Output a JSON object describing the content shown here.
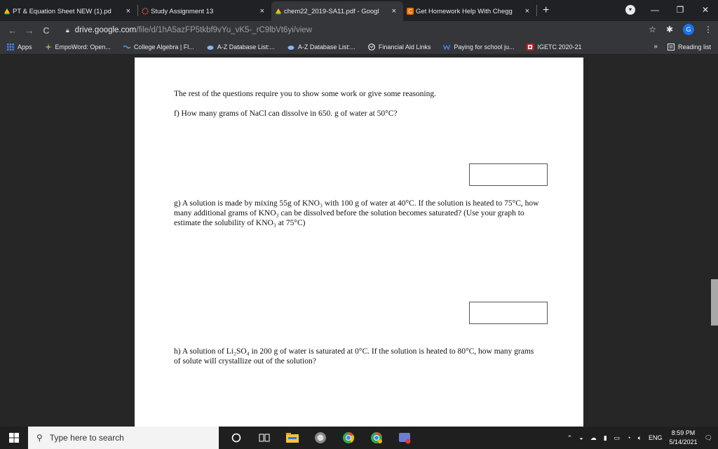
{
  "tabs": [
    {
      "label": "PT & Equation Sheet NEW (1).pd",
      "icon": "google-drive-icon",
      "active": false
    },
    {
      "label": "Study Assignment 13",
      "icon": "flower-icon",
      "active": false
    },
    {
      "label": "chem22_2019-SA11.pdf - Googl",
      "icon": "google-drive-icon",
      "active": true
    },
    {
      "label": "Get Homework Help With Chegg",
      "icon": "chegg-icon",
      "active": false
    }
  ],
  "tab_close": "×",
  "new_tab": "+",
  "window": {
    "minimize": "—",
    "restore": "❐",
    "close": "✕"
  },
  "toolbar": {
    "back": "←",
    "forward": "→",
    "reload": "C",
    "url_host": "drive.google.com",
    "url_path": "/file/d/1hA5azFP5tkbf9vYu_vK5-_rC9lbVt6yi/view",
    "star": "☆",
    "extension": "✱",
    "avatar": "G",
    "menu": "⋮"
  },
  "bookmarks": [
    {
      "label": "Apps",
      "icon": "apps-grid-icon",
      "color": "#4285f4"
    },
    {
      "label": "EmpoWord: Open...",
      "icon": "empoword-icon",
      "color": "#8ab34a"
    },
    {
      "label": "College Algebra | Fl...",
      "icon": "wave-icon",
      "color": "#4fa3e0"
    },
    {
      "label": "A-Z Database List:...",
      "icon": "cloud-icon",
      "color": "#8ab4f8"
    },
    {
      "label": "A-Z Database List:...",
      "icon": "cloud-icon",
      "color": "#8ab4f8"
    },
    {
      "label": "Financial Aid Links",
      "icon": "globe-icon",
      "color": "#e8eaed"
    },
    {
      "label": "Paying for school ju...",
      "icon": "w-icon",
      "color": "#4285f4"
    },
    {
      "label": "IGETC 2020-21",
      "icon": "igetc-icon",
      "color": "#c5221f"
    }
  ],
  "bookmarks_more": "»",
  "reading_list": "Reading list",
  "document": {
    "intro": "The rest of the questions require you to show some work or give some reasoning.",
    "q_f": "f) How many grams of NaCl can dissolve in 650. g of water at 50°C?",
    "q_g": "g) A solution is made by mixing 55g of KNO₃ with 100 g of water at 40°C.  If the solution is heated to 75°C, how many additional grams of KNO₃ can be dissolved before the solution becomes saturated? (Use your graph to estimate the solubility of KNO₃ at 75°C)",
    "q_h": "h) A solution of Li₂SO₄ in 200 g of water is saturated at 0°C.  If the solution is heated to 80°C, how many grams of solute will crystallize out of the solution?"
  },
  "taskbar": {
    "search_placeholder": "Type here to search",
    "apps": [
      "cortana-icon",
      "task-view-icon",
      "file-explorer-icon",
      "edge-icon",
      "chrome-icon",
      "chrome-profile-icon",
      "snip-icon"
    ],
    "language": "ENG",
    "time": "8:59 PM",
    "date": "5/14/2021"
  }
}
